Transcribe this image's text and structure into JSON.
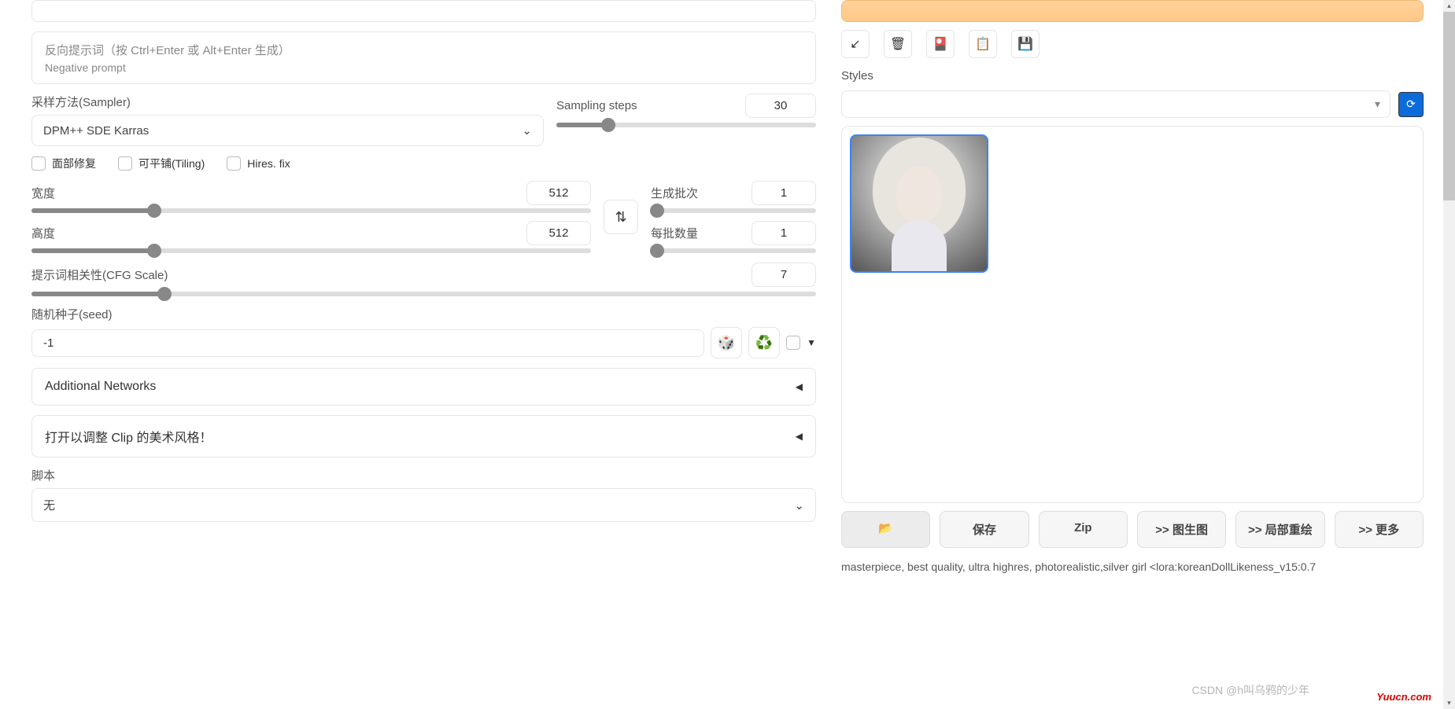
{
  "neg_placeholder_cn": "反向提示词（按 Ctrl+Enter 或 Alt+Enter 生成）",
  "neg_placeholder_en": "Negative prompt",
  "sampler": {
    "label": "采样方法(Sampler)",
    "value": "DPM++ SDE Karras"
  },
  "steps": {
    "label": "Sampling steps",
    "value": "30"
  },
  "checks": {
    "face": "面部修复",
    "tiling": "可平铺(Tiling)",
    "hires": "Hires. fix"
  },
  "width": {
    "label": "宽度",
    "value": "512"
  },
  "height": {
    "label": "高度",
    "value": "512"
  },
  "batch_count": {
    "label": "生成批次",
    "value": "1"
  },
  "batch_size": {
    "label": "每批数量",
    "value": "1"
  },
  "cfg": {
    "label": "提示词相关性(CFG Scale)",
    "value": "7"
  },
  "seed": {
    "label": "随机种子(seed)",
    "value": "-1"
  },
  "accordion1": "Additional Networks",
  "accordion2": "打开以调整 Clip 的美术风格！",
  "script": {
    "label": "脚本",
    "value": "无"
  },
  "styles_label": "Styles",
  "actions": {
    "folder": "📂",
    "save": "保存",
    "zip": "Zip",
    "img2img": ">> 图生图",
    "inpaint": ">> 局部重绘",
    "more": ">> 更多"
  },
  "prompt_output": "masterpiece, best quality, ultra highres, photorealistic,silver girl <lora:koreanDollLikeness_v15:0.7",
  "watermark_site": "Yuucn.com",
  "watermark_csdn": "CSDN @h叫乌鸦的少年"
}
